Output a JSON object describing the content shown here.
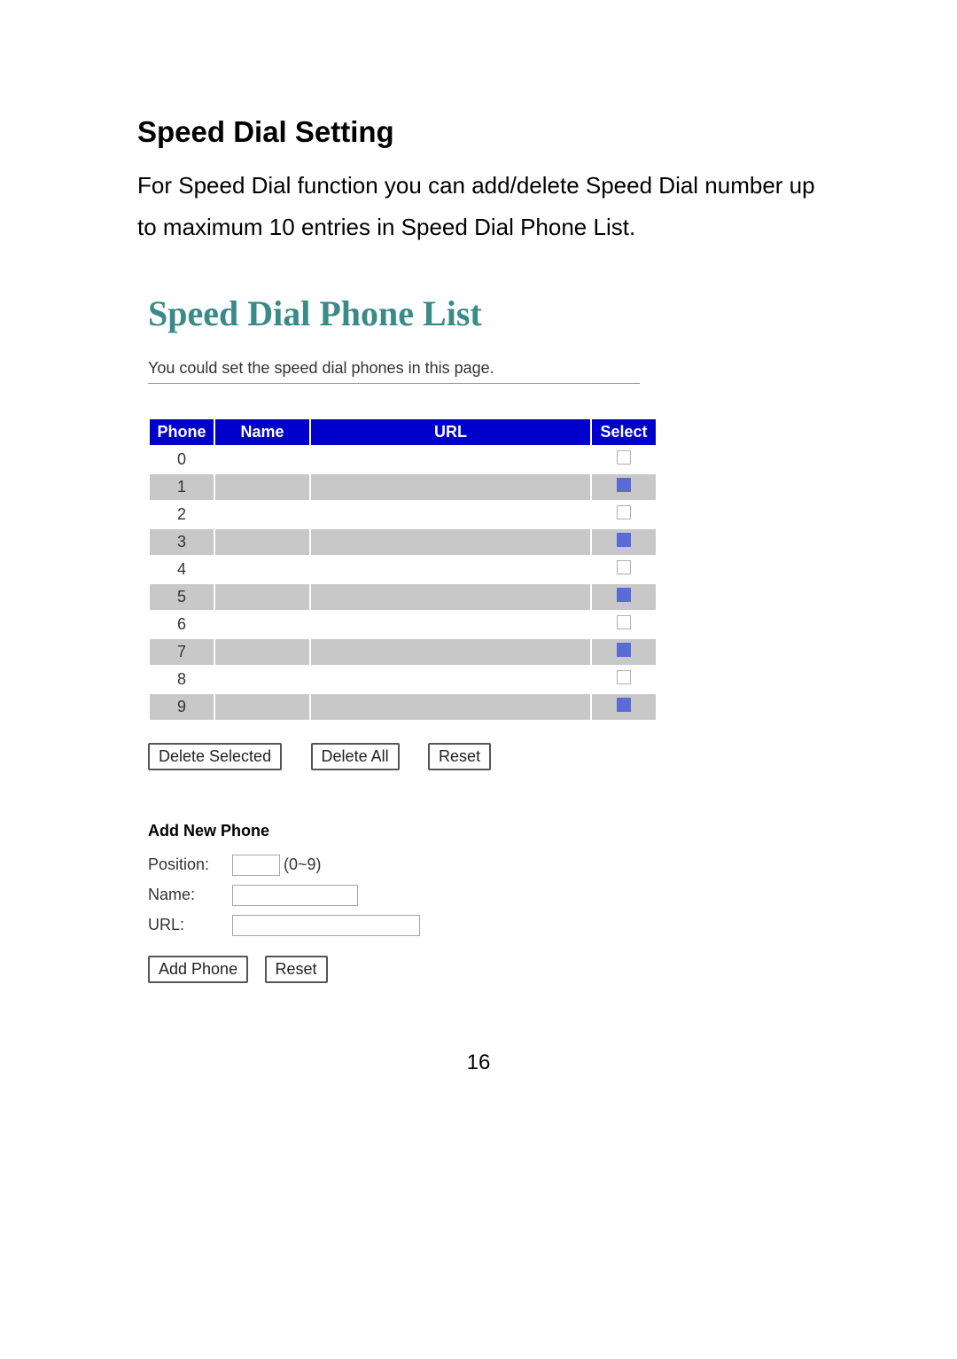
{
  "doc": {
    "title": "Speed Dial Setting",
    "description": "For Speed Dial function you can add/delete Speed Dial number up to maximum 10 entries in Speed Dial Phone List."
  },
  "list": {
    "title": "Speed Dial Phone List",
    "subtitle": "You could set the speed dial phones in this page.",
    "headers": {
      "phone": "Phone",
      "name": "Name",
      "url": "URL",
      "select": "Select"
    },
    "rows": [
      {
        "phone": "0",
        "name": "",
        "url": ""
      },
      {
        "phone": "1",
        "name": "",
        "url": ""
      },
      {
        "phone": "2",
        "name": "",
        "url": ""
      },
      {
        "phone": "3",
        "name": "",
        "url": ""
      },
      {
        "phone": "4",
        "name": "",
        "url": ""
      },
      {
        "phone": "5",
        "name": "",
        "url": ""
      },
      {
        "phone": "6",
        "name": "",
        "url": ""
      },
      {
        "phone": "7",
        "name": "",
        "url": ""
      },
      {
        "phone": "8",
        "name": "",
        "url": ""
      },
      {
        "phone": "9",
        "name": "",
        "url": ""
      }
    ],
    "buttons": {
      "delete_selected": "Delete Selected",
      "delete_all": "Delete All",
      "reset": "Reset"
    }
  },
  "add": {
    "title": "Add New Phone",
    "labels": {
      "position": "Position:",
      "name": "Name:",
      "url": "URL:"
    },
    "hints": {
      "position": "(0~9)"
    },
    "buttons": {
      "add_phone": "Add Phone",
      "reset": "Reset"
    }
  },
  "page": {
    "number": "16"
  }
}
